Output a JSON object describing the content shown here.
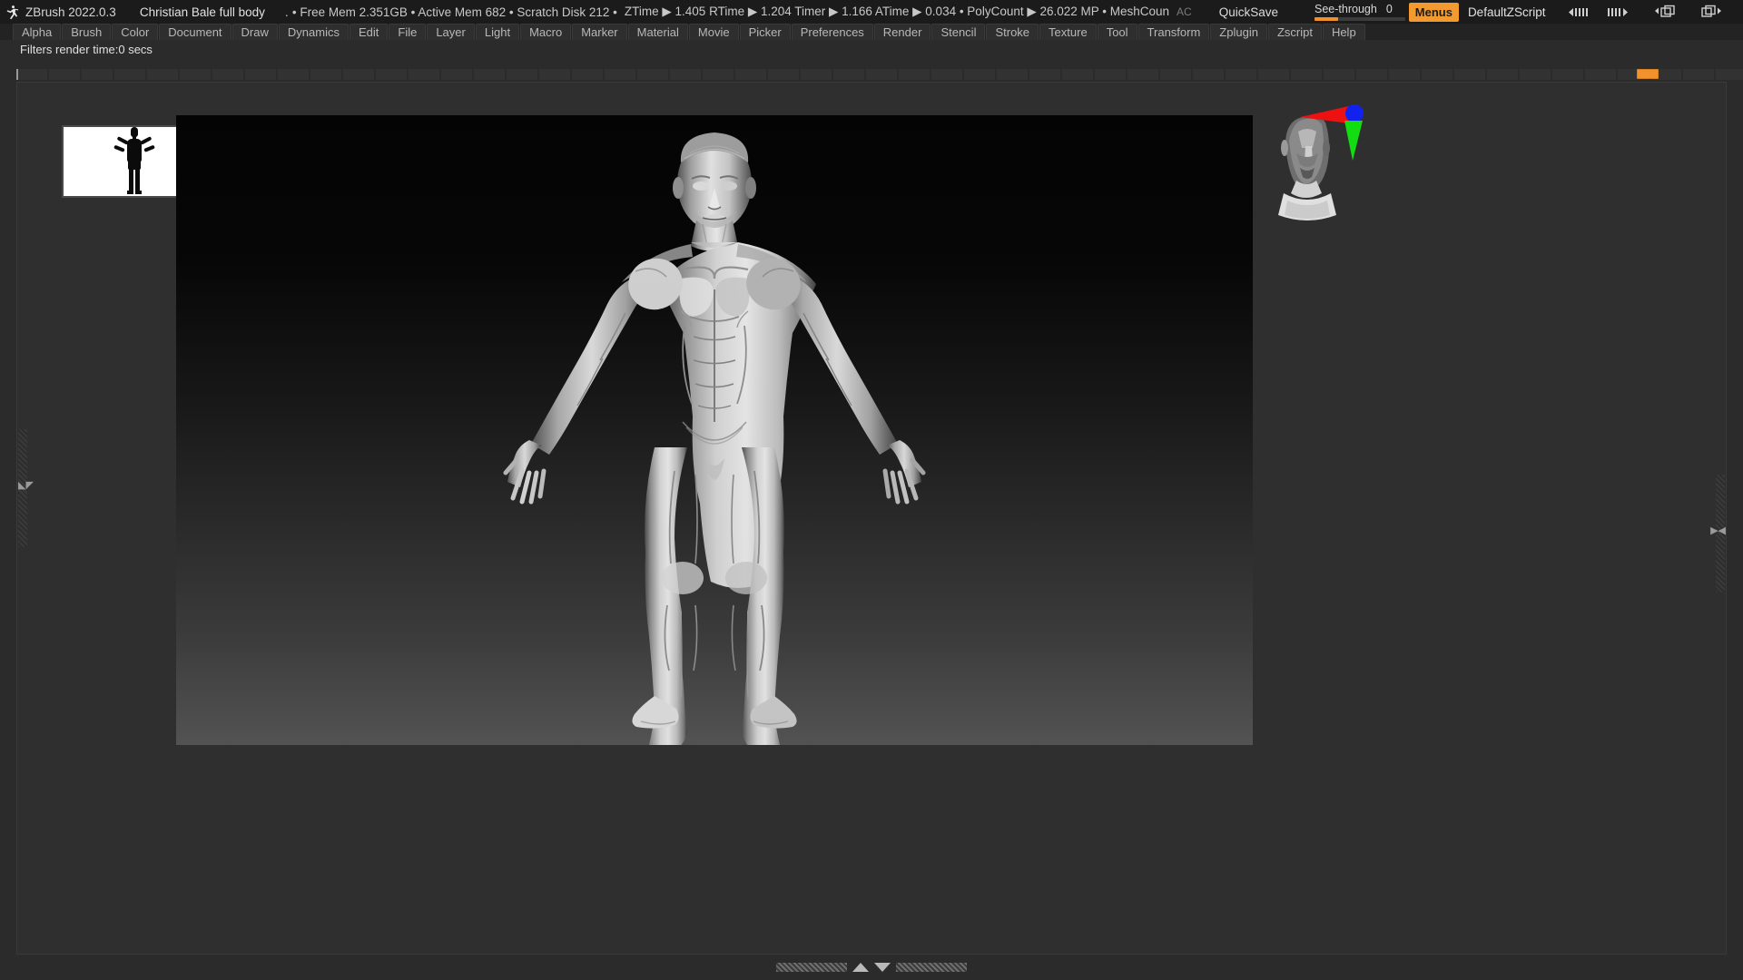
{
  "titlebar": {
    "logo_icon": "zbrush-runner-icon",
    "version": "ZBrush 2022.0.3",
    "document_name": "Christian Bale full body",
    "separator": ".",
    "memory_stats": "• Free Mem 2.351GB • Active Mem 682 • Scratch Disk 212 •",
    "timing_stats": "ZTime ▶ 1.405 RTime ▶ 1.204 Timer ▶ 1.166 ATime ▶ 0.034 • PolyCount ▶ 26.022 MP • MeshCoun",
    "ac_label": "AC",
    "quicksave_label": "QuickSave",
    "seethrough_label": "See-through",
    "seethrough_value": "0",
    "menus_label": "Menus",
    "zscript_label": "DefaultZScript",
    "prev_slider_icon": "slider-left-icon",
    "next_slider_icon": "slider-right-icon",
    "prev_layout_icon": "layout-prev-icon",
    "next_layout_icon": "layout-next-icon",
    "minimize_label": "⏷",
    "restore_label": "❐",
    "close_label": "✕",
    "accent_color": "#f29a30"
  },
  "menubar": {
    "items": [
      {
        "label": "Alpha"
      },
      {
        "label": "Brush"
      },
      {
        "label": "Color"
      },
      {
        "label": "Document"
      },
      {
        "label": "Draw"
      },
      {
        "label": "Dynamics"
      },
      {
        "label": "Edit"
      },
      {
        "label": "File"
      },
      {
        "label": "Layer"
      },
      {
        "label": "Light"
      },
      {
        "label": "Macro"
      },
      {
        "label": "Marker"
      },
      {
        "label": "Material"
      },
      {
        "label": "Movie"
      },
      {
        "label": "Picker"
      },
      {
        "label": "Preferences"
      },
      {
        "label": "Render"
      },
      {
        "label": "Stencil"
      },
      {
        "label": "Stroke"
      },
      {
        "label": "Texture"
      },
      {
        "label": "Tool"
      },
      {
        "label": "Transform"
      },
      {
        "label": "Zplugin"
      },
      {
        "label": "Zscript"
      },
      {
        "label": "Help"
      }
    ]
  },
  "status": {
    "render_time_text": "Filters render time:0 secs"
  },
  "shelf": {
    "active_swatch_color": "#f2922c"
  },
  "document": {
    "thumbnail_name": "document-thumbnail",
    "canvas_name": "3d-canvas",
    "model_subject": "male-anatomy-figure"
  },
  "gizmo": {
    "name": "navigation-gizmo",
    "x_axis_color": "#ee1111",
    "y_axis_color": "#11dd11",
    "z_axis_color": "#1122ee"
  },
  "bottombar": {
    "up_arrow_icon": "tray-expand-up-icon",
    "down_arrow_icon": "tray-collapse-down-icon"
  }
}
